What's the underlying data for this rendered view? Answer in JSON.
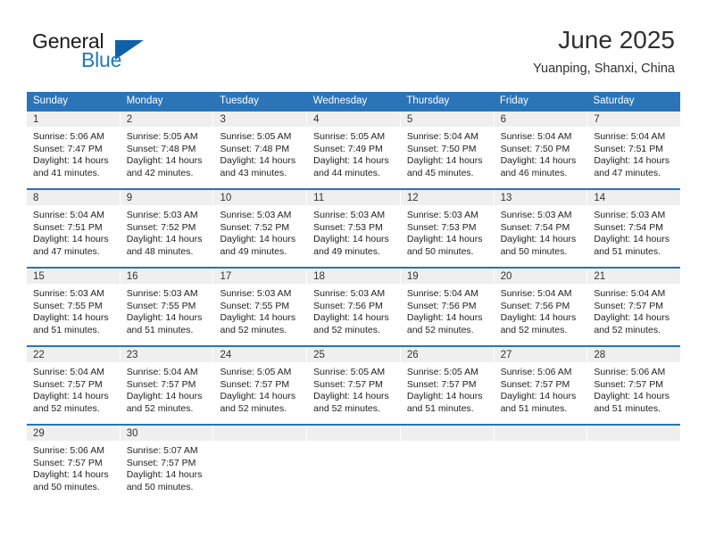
{
  "brand": {
    "name_part1": "General",
    "name_part2": "Blue",
    "accent_color": "#1f78c1",
    "triangle_color": "#1060aa"
  },
  "header": {
    "month_title": "June 2025",
    "location": "Yuanping, Shanxi, China"
  },
  "calendar": {
    "header_bg": "#2b74b8",
    "daynum_bg": "#efefef",
    "weekdays": [
      "Sunday",
      "Monday",
      "Tuesday",
      "Wednesday",
      "Thursday",
      "Friday",
      "Saturday"
    ],
    "weeks": [
      [
        {
          "day": "1",
          "sunrise": "Sunrise: 5:06 AM",
          "sunset": "Sunset: 7:47 PM",
          "daylight_1": "Daylight: 14 hours",
          "daylight_2": "and 41 minutes."
        },
        {
          "day": "2",
          "sunrise": "Sunrise: 5:05 AM",
          "sunset": "Sunset: 7:48 PM",
          "daylight_1": "Daylight: 14 hours",
          "daylight_2": "and 42 minutes."
        },
        {
          "day": "3",
          "sunrise": "Sunrise: 5:05 AM",
          "sunset": "Sunset: 7:48 PM",
          "daylight_1": "Daylight: 14 hours",
          "daylight_2": "and 43 minutes."
        },
        {
          "day": "4",
          "sunrise": "Sunrise: 5:05 AM",
          "sunset": "Sunset: 7:49 PM",
          "daylight_1": "Daylight: 14 hours",
          "daylight_2": "and 44 minutes."
        },
        {
          "day": "5",
          "sunrise": "Sunrise: 5:04 AM",
          "sunset": "Sunset: 7:50 PM",
          "daylight_1": "Daylight: 14 hours",
          "daylight_2": "and 45 minutes."
        },
        {
          "day": "6",
          "sunrise": "Sunrise: 5:04 AM",
          "sunset": "Sunset: 7:50 PM",
          "daylight_1": "Daylight: 14 hours",
          "daylight_2": "and 46 minutes."
        },
        {
          "day": "7",
          "sunrise": "Sunrise: 5:04 AM",
          "sunset": "Sunset: 7:51 PM",
          "daylight_1": "Daylight: 14 hours",
          "daylight_2": "and 47 minutes."
        }
      ],
      [
        {
          "day": "8",
          "sunrise": "Sunrise: 5:04 AM",
          "sunset": "Sunset: 7:51 PM",
          "daylight_1": "Daylight: 14 hours",
          "daylight_2": "and 47 minutes."
        },
        {
          "day": "9",
          "sunrise": "Sunrise: 5:03 AM",
          "sunset": "Sunset: 7:52 PM",
          "daylight_1": "Daylight: 14 hours",
          "daylight_2": "and 48 minutes."
        },
        {
          "day": "10",
          "sunrise": "Sunrise: 5:03 AM",
          "sunset": "Sunset: 7:52 PM",
          "daylight_1": "Daylight: 14 hours",
          "daylight_2": "and 49 minutes."
        },
        {
          "day": "11",
          "sunrise": "Sunrise: 5:03 AM",
          "sunset": "Sunset: 7:53 PM",
          "daylight_1": "Daylight: 14 hours",
          "daylight_2": "and 49 minutes."
        },
        {
          "day": "12",
          "sunrise": "Sunrise: 5:03 AM",
          "sunset": "Sunset: 7:53 PM",
          "daylight_1": "Daylight: 14 hours",
          "daylight_2": "and 50 minutes."
        },
        {
          "day": "13",
          "sunrise": "Sunrise: 5:03 AM",
          "sunset": "Sunset: 7:54 PM",
          "daylight_1": "Daylight: 14 hours",
          "daylight_2": "and 50 minutes."
        },
        {
          "day": "14",
          "sunrise": "Sunrise: 5:03 AM",
          "sunset": "Sunset: 7:54 PM",
          "daylight_1": "Daylight: 14 hours",
          "daylight_2": "and 51 minutes."
        }
      ],
      [
        {
          "day": "15",
          "sunrise": "Sunrise: 5:03 AM",
          "sunset": "Sunset: 7:55 PM",
          "daylight_1": "Daylight: 14 hours",
          "daylight_2": "and 51 minutes."
        },
        {
          "day": "16",
          "sunrise": "Sunrise: 5:03 AM",
          "sunset": "Sunset: 7:55 PM",
          "daylight_1": "Daylight: 14 hours",
          "daylight_2": "and 51 minutes."
        },
        {
          "day": "17",
          "sunrise": "Sunrise: 5:03 AM",
          "sunset": "Sunset: 7:55 PM",
          "daylight_1": "Daylight: 14 hours",
          "daylight_2": "and 52 minutes."
        },
        {
          "day": "18",
          "sunrise": "Sunrise: 5:03 AM",
          "sunset": "Sunset: 7:56 PM",
          "daylight_1": "Daylight: 14 hours",
          "daylight_2": "and 52 minutes."
        },
        {
          "day": "19",
          "sunrise": "Sunrise: 5:04 AM",
          "sunset": "Sunset: 7:56 PM",
          "daylight_1": "Daylight: 14 hours",
          "daylight_2": "and 52 minutes."
        },
        {
          "day": "20",
          "sunrise": "Sunrise: 5:04 AM",
          "sunset": "Sunset: 7:56 PM",
          "daylight_1": "Daylight: 14 hours",
          "daylight_2": "and 52 minutes."
        },
        {
          "day": "21",
          "sunrise": "Sunrise: 5:04 AM",
          "sunset": "Sunset: 7:57 PM",
          "daylight_1": "Daylight: 14 hours",
          "daylight_2": "and 52 minutes."
        }
      ],
      [
        {
          "day": "22",
          "sunrise": "Sunrise: 5:04 AM",
          "sunset": "Sunset: 7:57 PM",
          "daylight_1": "Daylight: 14 hours",
          "daylight_2": "and 52 minutes."
        },
        {
          "day": "23",
          "sunrise": "Sunrise: 5:04 AM",
          "sunset": "Sunset: 7:57 PM",
          "daylight_1": "Daylight: 14 hours",
          "daylight_2": "and 52 minutes."
        },
        {
          "day": "24",
          "sunrise": "Sunrise: 5:05 AM",
          "sunset": "Sunset: 7:57 PM",
          "daylight_1": "Daylight: 14 hours",
          "daylight_2": "and 52 minutes."
        },
        {
          "day": "25",
          "sunrise": "Sunrise: 5:05 AM",
          "sunset": "Sunset: 7:57 PM",
          "daylight_1": "Daylight: 14 hours",
          "daylight_2": "and 52 minutes."
        },
        {
          "day": "26",
          "sunrise": "Sunrise: 5:05 AM",
          "sunset": "Sunset: 7:57 PM",
          "daylight_1": "Daylight: 14 hours",
          "daylight_2": "and 51 minutes."
        },
        {
          "day": "27",
          "sunrise": "Sunrise: 5:06 AM",
          "sunset": "Sunset: 7:57 PM",
          "daylight_1": "Daylight: 14 hours",
          "daylight_2": "and 51 minutes."
        },
        {
          "day": "28",
          "sunrise": "Sunrise: 5:06 AM",
          "sunset": "Sunset: 7:57 PM",
          "daylight_1": "Daylight: 14 hours",
          "daylight_2": "and 51 minutes."
        }
      ],
      [
        {
          "day": "29",
          "sunrise": "Sunrise: 5:06 AM",
          "sunset": "Sunset: 7:57 PM",
          "daylight_1": "Daylight: 14 hours",
          "daylight_2": "and 50 minutes."
        },
        {
          "day": "30",
          "sunrise": "Sunrise: 5:07 AM",
          "sunset": "Sunset: 7:57 PM",
          "daylight_1": "Daylight: 14 hours",
          "daylight_2": "and 50 minutes."
        },
        {
          "day": "",
          "sunrise": "",
          "sunset": "",
          "daylight_1": "",
          "daylight_2": ""
        },
        {
          "day": "",
          "sunrise": "",
          "sunset": "",
          "daylight_1": "",
          "daylight_2": ""
        },
        {
          "day": "",
          "sunrise": "",
          "sunset": "",
          "daylight_1": "",
          "daylight_2": ""
        },
        {
          "day": "",
          "sunrise": "",
          "sunset": "",
          "daylight_1": "",
          "daylight_2": ""
        },
        {
          "day": "",
          "sunrise": "",
          "sunset": "",
          "daylight_1": "",
          "daylight_2": ""
        }
      ]
    ]
  }
}
